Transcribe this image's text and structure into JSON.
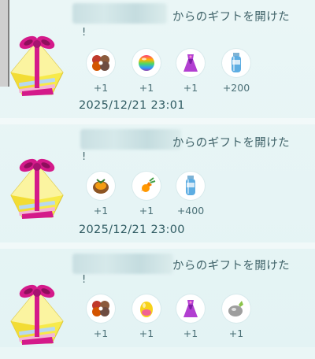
{
  "colors": {
    "background": "#e6f5f5",
    "text": "#3f6268",
    "gift_pink": "#d41a8a",
    "gift_yellow": "#f7ea4a"
  },
  "gift_log": [
    {
      "title": "からのギフトを開けた",
      "exclamation": "!",
      "items": [
        {
          "icon": "pokeball-cluster-icon",
          "qty": "+1"
        },
        {
          "icon": "rainbow-ball-icon",
          "qty": "+1"
        },
        {
          "icon": "purple-dress-icon",
          "qty": "+1"
        },
        {
          "icon": "potion-bottle-icon",
          "qty": "+200"
        }
      ],
      "timestamp": "2025/12/21 23:01"
    },
    {
      "title": "からのギフトを開けた",
      "exclamation": "!",
      "items": [
        {
          "icon": "berry-pinap-icon",
          "qty": "+1"
        },
        {
          "icon": "orange-carrot-icon",
          "qty": "+1"
        },
        {
          "icon": "potion-bottle-icon",
          "qty": "+400"
        }
      ],
      "timestamp": "2025/12/21 23:00"
    },
    {
      "title": "からのギフトを開けた",
      "exclamation": "!",
      "items": [
        {
          "icon": "pokeball-cluster-icon",
          "qty": "+1"
        },
        {
          "icon": "yellow-egg-icon",
          "qty": "+1"
        },
        {
          "icon": "purple-dress-icon",
          "qty": "+1"
        },
        {
          "icon": "silver-stone-icon",
          "qty": "+1"
        }
      ]
    }
  ]
}
